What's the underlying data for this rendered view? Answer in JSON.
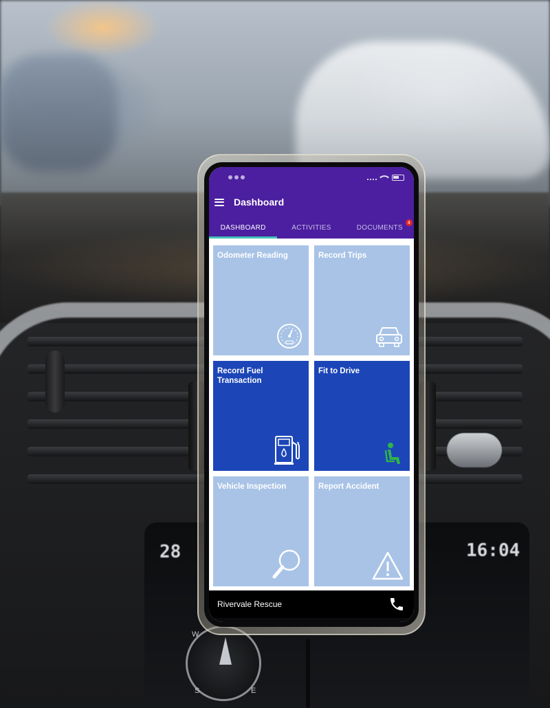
{
  "app": {
    "title": "Dashboard"
  },
  "tabs": [
    {
      "label": "DASHBOARD",
      "active": true
    },
    {
      "label": "ACTIVITIES",
      "active": false
    },
    {
      "label": "DOCUMENTS",
      "active": false,
      "badge": "4"
    }
  ],
  "tiles": [
    {
      "label": "Odometer Reading",
      "style": "light",
      "icon": "speedometer-icon"
    },
    {
      "label": "Record Trips",
      "style": "light",
      "icon": "car-icon"
    },
    {
      "label": "Record Fuel Transaction",
      "style": "dark",
      "icon": "fuel-pump-icon"
    },
    {
      "label": "Fit to Drive",
      "style": "dark",
      "icon": "seated-person-icon"
    },
    {
      "label": "Vehicle Inspection",
      "style": "light",
      "icon": "magnifier-icon"
    },
    {
      "label": "Report Accident",
      "style": "light",
      "icon": "warning-icon"
    }
  ],
  "bottom_bar": {
    "label": "Rivervale Rescue",
    "icon": "phone-icon"
  },
  "dashboard_display": {
    "temperature": "28",
    "time": "16:04",
    "compass": [
      "W",
      "S",
      "E"
    ]
  },
  "colors": {
    "app_bar": "#4b1fa0",
    "tab_indicator": "#44c2b8",
    "tile_light": "#a8c3e6",
    "tile_dark": "#1c46b8",
    "badge": "#e02424",
    "fit_to_drive_icon": "#2fb34a"
  }
}
